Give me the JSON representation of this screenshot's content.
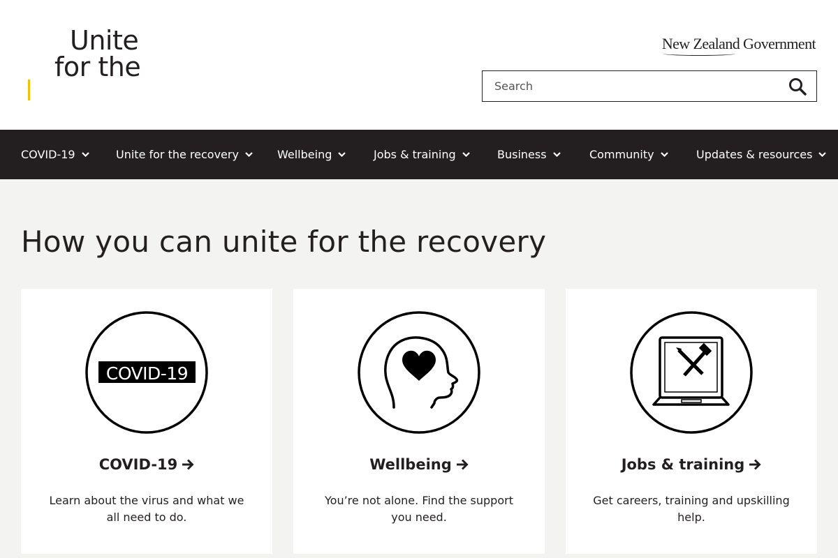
{
  "header": {
    "logo_line1": "Unite",
    "logo_line2": "for the",
    "gov_logo": "New Zealand Government",
    "search_placeholder": "Search"
  },
  "nav": {
    "items": [
      {
        "label": "COVID-19"
      },
      {
        "label": "Unite for the recovery"
      },
      {
        "label": "Wellbeing"
      },
      {
        "label": "Jobs & training"
      },
      {
        "label": "Business"
      },
      {
        "label": "Community"
      },
      {
        "label": "Updates & resources"
      }
    ]
  },
  "main": {
    "heading": "How you can unite for the recovery",
    "cards": [
      {
        "icon": "covid-19-icon",
        "icon_text": "COVID-19",
        "title": "COVID-19",
        "description": "Learn about the virus and what we all need to do."
      },
      {
        "icon": "head-heart-icon",
        "title": "Wellbeing",
        "description": "You’re not alone. Find the support you need."
      },
      {
        "icon": "laptop-tools-icon",
        "title": "Jobs & training",
        "description": "Get careers, training and upskilling help."
      }
    ]
  },
  "colors": {
    "nav_background": "#231f20",
    "page_background": "#f3f3f2",
    "logo_accent": "#f2c200"
  }
}
